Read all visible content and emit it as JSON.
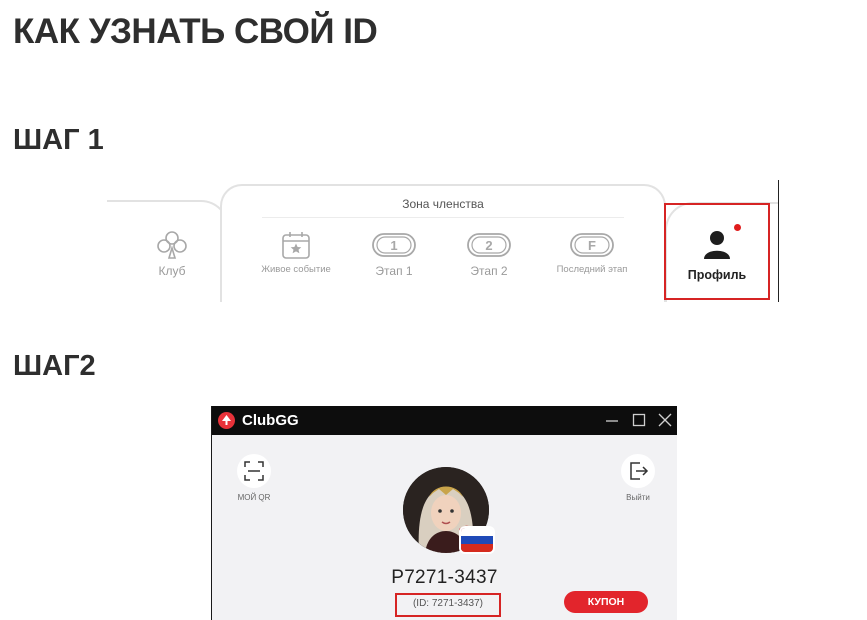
{
  "page": {
    "title": "КАК УЗНАТЬ СВОЙ ID",
    "step1_heading": "ШАГ 1",
    "step2_heading": "ШАГ2"
  },
  "step1": {
    "zone_title": "Зона членства",
    "tabs": [
      {
        "label": "Клуб",
        "icon": "club-icon"
      },
      {
        "label": "Живое событие",
        "icon": "calendar-star-icon"
      },
      {
        "label": "Этап 1",
        "icon": "stage-1-icon"
      },
      {
        "label": "Этап 2",
        "icon": "stage-2-icon"
      },
      {
        "label": "Последний этап",
        "icon": "final-stage-icon"
      },
      {
        "label": "Профиль",
        "icon": "profile-icon",
        "highlighted": true
      }
    ],
    "accent_color": "#d62424"
  },
  "step2": {
    "app_name": "ClubGG",
    "window_controls": [
      "minimize",
      "maximize",
      "close"
    ],
    "my_qr_label": "МОЙ QR",
    "logout_label": "Выйти",
    "player_name": "P7271-3437",
    "player_id_text": "(ID: 7271-3437)",
    "coupon_label": "КУПОН",
    "flag": "russia-flag",
    "coupon_color": "#e2252c"
  }
}
